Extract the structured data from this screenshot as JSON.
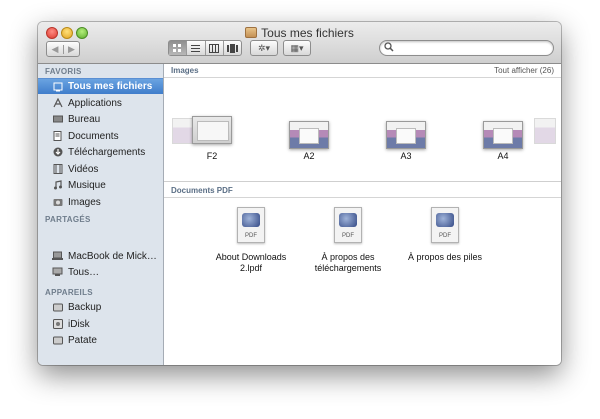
{
  "window": {
    "title": "Tous mes fichiers"
  },
  "toolbar": {
    "back_label": "◀",
    "forward_label": "▶",
    "view_icon": "icon-view",
    "view_list": "list-view",
    "view_columns": "column-view",
    "view_coverflow": "coverflow-view",
    "action_label": "✲▾",
    "arrange_label": "▦▾",
    "search_placeholder": ""
  },
  "sidebar": {
    "favorites_header": "FAVORIS",
    "favorites": [
      {
        "label": "Tous mes fichiers",
        "icon": "all-files-icon"
      },
      {
        "label": "Applications",
        "icon": "applications-icon"
      },
      {
        "label": "Bureau",
        "icon": "desktop-icon"
      },
      {
        "label": "Documents",
        "icon": "documents-icon"
      },
      {
        "label": "Téléchargements",
        "icon": "downloads-icon"
      },
      {
        "label": "Vidéos",
        "icon": "movies-icon"
      },
      {
        "label": "Musique",
        "icon": "music-icon"
      },
      {
        "label": "Images",
        "icon": "pictures-icon"
      }
    ],
    "shared_header": "PARTAGÉS",
    "shared": [
      {
        "label": "MacBook de Mick…",
        "icon": "laptop-icon"
      },
      {
        "label": "Tous…",
        "icon": "network-icon"
      }
    ],
    "devices_header": "APPAREILS",
    "devices": [
      {
        "label": "Backup",
        "icon": "disk-icon"
      },
      {
        "label": "iDisk",
        "icon": "idisk-icon"
      },
      {
        "label": "Patate",
        "icon": "disk-icon"
      }
    ]
  },
  "images_section": {
    "title": "Images",
    "show_all": "Tout afficher (26)",
    "items": [
      "F2",
      "A2",
      "A3",
      "A4"
    ]
  },
  "pdf_section": {
    "title": "Documents PDF",
    "items": [
      {
        "line1": "About Downloads",
        "line2": "2.lpdf"
      },
      {
        "line1": "À propos des",
        "line2": "téléchargements"
      },
      {
        "line1": "À propos des piles",
        "line2": ""
      }
    ],
    "badge_text": "PDF"
  }
}
